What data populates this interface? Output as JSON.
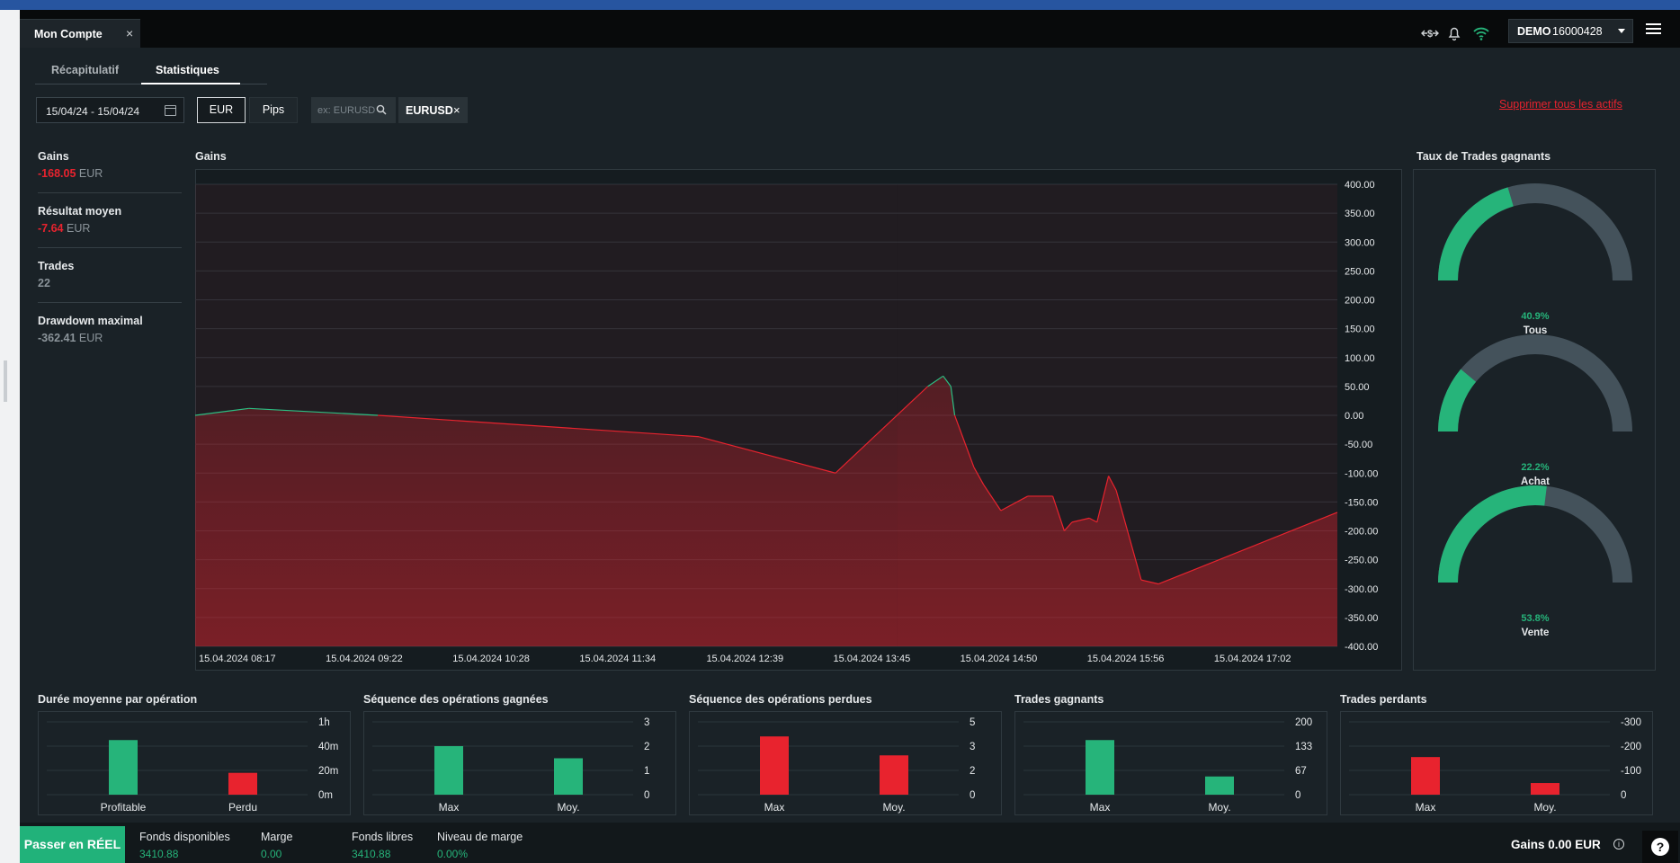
{
  "header": {
    "tab_title": "Mon Compte",
    "tab_close": "×",
    "account_mode": "DEMO",
    "account_number": "16000428"
  },
  "subtabs": [
    "Récapitulatif",
    "Statistiques"
  ],
  "filters": {
    "date_range": "15/04/24 - 15/04/24",
    "unit_eur": "EUR",
    "unit_pips": "Pips",
    "search_placeholder": "ex: EURUSD",
    "selected_asset": "EURUSD",
    "chip_close": "×",
    "delete_all": "Supprimer tous les actifs"
  },
  "stats": [
    {
      "label": "Gains",
      "value": "-168.05",
      "unit": "EUR"
    },
    {
      "label": "Résultat moyen",
      "value": "-7.64",
      "unit": "EUR"
    },
    {
      "label": "Trades",
      "value": "22",
      "unit": ""
    },
    {
      "label": "Drawdown maximal",
      "value": "-362.41",
      "unit": "EUR"
    }
  ],
  "gauges_title": "Taux de Trades gagnants",
  "gauges": [
    {
      "label": "Tous",
      "pct_text": "40.9%",
      "value": 0.409
    },
    {
      "label": "Achat",
      "pct_text": "22.2%",
      "value": 0.222
    },
    {
      "label": "Vente",
      "pct_text": "53.8%",
      "value": 0.538
    }
  ],
  "chart_data": [
    {
      "type": "area",
      "title": "Gains",
      "ylim": [
        -400,
        400
      ],
      "yticks": [
        "400.00",
        "350.00",
        "300.00",
        "250.00",
        "200.00",
        "150.00",
        "100.00",
        "50.00",
        "0.00",
        "-50.00",
        "-100.00",
        "-150.00",
        "-200.00",
        "-250.00",
        "-300.00",
        "-350.00",
        "-400.00"
      ],
      "xticks": [
        "15.04.2024 08:17",
        "15.04.2024 09:22",
        "15.04.2024 10:28",
        "15.04.2024 11:34",
        "15.04.2024 12:39",
        "15.04.2024 13:45",
        "15.04.2024 14:50",
        "15.04.2024 15:56",
        "15.04.2024 17:02"
      ],
      "x": [
        "08:17",
        "08:45",
        "09:52",
        "12:39",
        "13:50",
        "14:38",
        "14:46",
        "14:50",
        "14:52",
        "15:02",
        "15:07",
        "15:16",
        "15:30",
        "15:43",
        "15:49",
        "15:53",
        "16:02",
        "16:06",
        "16:12",
        "16:16",
        "16:29",
        "16:38",
        "18:11"
      ],
      "y": [
        0,
        12,
        0,
        -37,
        -100,
        50,
        68,
        50,
        0,
        -90,
        -120,
        -165,
        -140,
        -140,
        -200,
        -185,
        -178,
        -185,
        -105,
        -130,
        -285,
        -292,
        -168
      ],
      "grid": true,
      "colors": {
        "positive": "#1e7358",
        "negative": "#e8232e"
      }
    },
    {
      "type": "bar",
      "title": "Durée moyenne par opération",
      "categories": [
        "Profitable",
        "Perdu"
      ],
      "values": [
        45,
        18
      ],
      "yticks": [
        "1h",
        "40m",
        "20m",
        "0m"
      ],
      "ylim": [
        0,
        60
      ]
    },
    {
      "type": "bar",
      "title": "Séquence des opérations gagnées",
      "categories": [
        "Max",
        "Moy."
      ],
      "values": [
        2,
        1.5
      ],
      "yticks": [
        "3",
        "2",
        "1",
        "0"
      ],
      "ylim": [
        0,
        3
      ]
    },
    {
      "type": "bar",
      "title": "Séquence des opérations perdues",
      "categories": [
        "Max",
        "Moy."
      ],
      "values": [
        4,
        2.7
      ],
      "yticks": [
        "5",
        "3",
        "2",
        "0"
      ],
      "ylim": [
        0,
        5
      ]
    },
    {
      "type": "bar",
      "title": "Trades gagnants",
      "categories": [
        "Max",
        "Moy."
      ],
      "values": [
        150,
        50
      ],
      "yticks": [
        "200",
        "133",
        "67",
        "0"
      ],
      "ylim": [
        0,
        200
      ]
    },
    {
      "type": "bar",
      "title": "Trades perdants",
      "categories": [
        "Max",
        "Moy."
      ],
      "values": [
        -155,
        -48
      ],
      "yticks": [
        "-300",
        "-200",
        "-100",
        "0"
      ],
      "ylim": [
        -300,
        0
      ]
    }
  ],
  "footer": {
    "go_real": "Passer en RÉEL",
    "items": [
      {
        "label": "Fonds disponibles",
        "value": "3410.88"
      },
      {
        "label": "Marge",
        "value": "0.00"
      },
      {
        "label": "Fonds libres",
        "value": "3410.88"
      },
      {
        "label": "Niveau de marge",
        "value": "0.00%"
      }
    ],
    "gains": "Gains 0.00 EUR",
    "help": "?"
  },
  "colors": {
    "green": "#26b47a",
    "red": "#e8232e",
    "gauge_track": "#44525b"
  }
}
